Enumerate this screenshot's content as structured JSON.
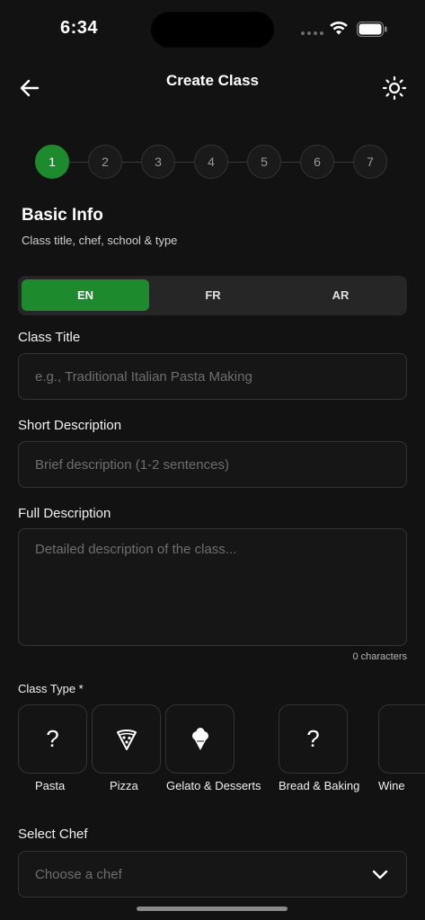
{
  "status_bar": {
    "time": "6:34"
  },
  "header": {
    "title": "Create Class",
    "back_icon": "arrow-left-icon",
    "theme_icon": "sun-icon"
  },
  "stepper": {
    "active_step": 1,
    "steps": [
      "1",
      "2",
      "3",
      "4",
      "5",
      "6",
      "7"
    ]
  },
  "section": {
    "title": "Basic Info",
    "subtitle": "Class title, chef, school & type"
  },
  "language_tabs": {
    "selected": "EN",
    "items": [
      "EN",
      "FR",
      "AR"
    ]
  },
  "form": {
    "class_title": {
      "label": "Class Title",
      "placeholder": "e.g., Traditional Italian Pasta Making",
      "value": ""
    },
    "short_description": {
      "label": "Short Description",
      "placeholder": "Brief description (1-2 sentences)",
      "value": ""
    },
    "full_description": {
      "label": "Full Description",
      "placeholder": "Detailed description of the class...",
      "value": "",
      "char_count": "0 characters"
    },
    "class_type": {
      "label": "Class Type *",
      "options": [
        {
          "name": "Pasta",
          "icon": "question-icon"
        },
        {
          "name": "Pizza",
          "icon": "pizza-icon"
        },
        {
          "name": "Gelato & Desserts",
          "icon": "ice-cream-icon"
        },
        {
          "name": "Bread & Baking",
          "icon": "question-icon"
        },
        {
          "name": "Wine",
          "icon": ""
        }
      ]
    },
    "select_chef": {
      "label": "Select Chef",
      "placeholder": "Choose a chef"
    }
  },
  "colors": {
    "accent": "#1e8a2e",
    "background": "#121212",
    "surface": "#161616",
    "border": "#333333"
  }
}
